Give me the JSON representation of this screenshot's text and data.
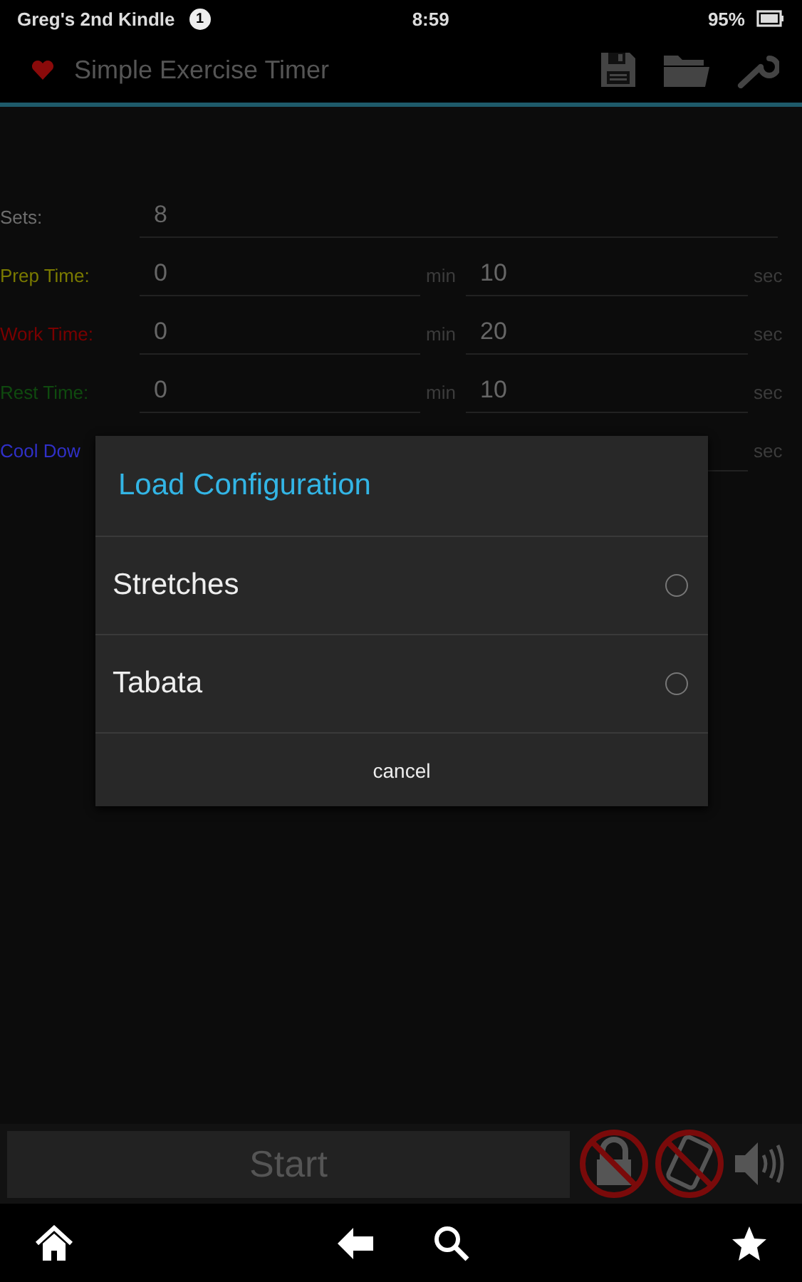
{
  "status_bar": {
    "device": "Greg's 2nd Kindle",
    "notification_count": "1",
    "time": "8:59",
    "battery": "95%"
  },
  "app_bar": {
    "title": "Simple Exercise Timer"
  },
  "form": {
    "rows": [
      {
        "label": "Sets:",
        "color": "#6e6e6e",
        "kind": "single",
        "value": "8"
      },
      {
        "label": "Prep Time:",
        "color": "#7a7a00",
        "kind": "time",
        "min": "0",
        "min_unit": "min",
        "sec": "10",
        "sec_unit": "sec"
      },
      {
        "label": "Work Time:",
        "color": "#7a0000",
        "kind": "time",
        "min": "0",
        "min_unit": "min",
        "sec": "20",
        "sec_unit": "sec"
      },
      {
        "label": "Rest Time:",
        "color": "#0f4a0f",
        "kind": "time",
        "min": "0",
        "min_unit": "min",
        "sec": "10",
        "sec_unit": "sec"
      },
      {
        "label": "Cool Dow",
        "color": "#3030c8",
        "kind": "hidden",
        "sec_unit": "sec"
      }
    ]
  },
  "dialog": {
    "title": "Load Configuration",
    "options": [
      {
        "label": "Stretches",
        "selected": false
      },
      {
        "label": "Tabata",
        "selected": false
      }
    ],
    "cancel": "cancel"
  },
  "bottom_bar": {
    "start": "Start"
  }
}
